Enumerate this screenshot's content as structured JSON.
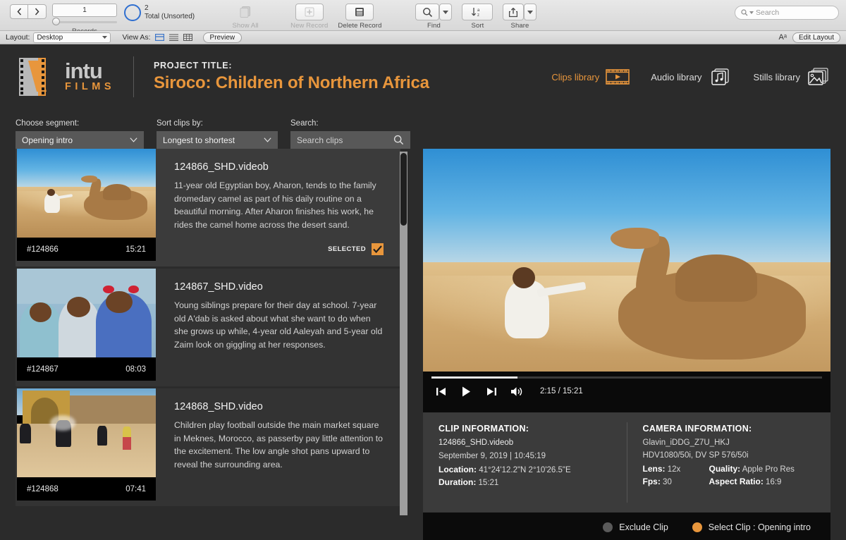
{
  "os_toolbar": {
    "nav_prev": "‹",
    "nav_next": "›",
    "record_number": "1",
    "records_label": "Records",
    "total_count": "2",
    "total_label": "Total (Unsorted)",
    "show_all_label": "Show All",
    "new_record_label": "New Record",
    "delete_record_label": "Delete Record",
    "find_label": "Find",
    "sort_label": "Sort",
    "share_label": "Share",
    "search_placeholder": "Search"
  },
  "layout_bar": {
    "layout_label": "Layout:",
    "layout_value": "Desktop",
    "view_as_label": "View As:",
    "preview_label": "Preview",
    "text_size_glyph": "Aᵃ",
    "edit_layout_label": "Edit Layout"
  },
  "header": {
    "logo_primary": "intu",
    "logo_secondary": "FILMS",
    "project_label": "PROJECT TITLE:",
    "project_title": "Siroco: Children of Northern Africa",
    "accent_color": "#e8963c",
    "libraries": [
      {
        "label": "Clips library",
        "icon": "film-strip-play-icon",
        "active": true
      },
      {
        "label": "Audio library",
        "icon": "music-note-cards-icon",
        "active": false
      },
      {
        "label": "Stills library",
        "icon": "photo-cards-icon",
        "active": false
      }
    ]
  },
  "filters": {
    "segment_label": "Choose segment:",
    "segment_value": "Opening intro",
    "sort_label": "Sort clips by:",
    "sort_value": "Longest to shortest",
    "search_label": "Search:",
    "search_placeholder": "Search clips"
  },
  "clips": [
    {
      "id": "#124866",
      "duration": "15:21",
      "name": "124866_SHD.videob",
      "description": "11-year old Egyptian boy, Aharon, tends to the family dromedary camel as part of his daily routine on a beautiful morning.  After Aharon finishes his work, he rides the camel home across the desert sand.",
      "selected": true,
      "selected_label": "SELECTED"
    },
    {
      "id": "#124867",
      "duration": "08:03",
      "name": "124867_SHD.video",
      "description": "Young siblings prepare for their day at school.  7-year old A'dab is asked about what she want to do when she grows up while, 4-year old Aaleyah and 5-year old Zaim look on giggling at her responses.",
      "selected": false,
      "selected_label": ""
    },
    {
      "id": "#124868",
      "duration": "07:41",
      "name": "124868_SHD.video",
      "description": "Children play football outside the main market square in Meknes, Morocco, as passerby pay little attention to the excitement.  The low angle shot pans upward to reveal the surrounding area.",
      "selected": false,
      "selected_label": ""
    }
  ],
  "player": {
    "current_time": "2:15",
    "total_time": "15:21",
    "time_display": "2:15 / 15:21",
    "progress_percent": 22
  },
  "clip_information": {
    "heading": "CLIP INFORMATION:",
    "filename": "124866_SHD.videob",
    "datetime": "September 9, 2019  |  10:45:19",
    "location_label": "Location:",
    "location_value": "41°24'12.2\"N  2°10'26.5\"E",
    "duration_label": "Duration:",
    "duration_value": "15:21"
  },
  "camera_information": {
    "heading": "CAMERA INFORMATION:",
    "camera_id": "Glavin_iDDG_Z7U_HKJ",
    "format": "HDV1080/50i, DV SP 576/50i",
    "lens_label": "Lens:",
    "lens_value": "12x",
    "quality_label": "Quality:",
    "quality_value": "Apple Pro Res",
    "fps_label": "Fps:",
    "fps_value": "30",
    "aspect_label": "Aspect Ratio:",
    "aspect_value": "16:9"
  },
  "actions": {
    "exclude_label": "Exclude Clip",
    "select_label": "Select Clip : Opening intro",
    "exclude_selected": false,
    "select_selected": true
  }
}
